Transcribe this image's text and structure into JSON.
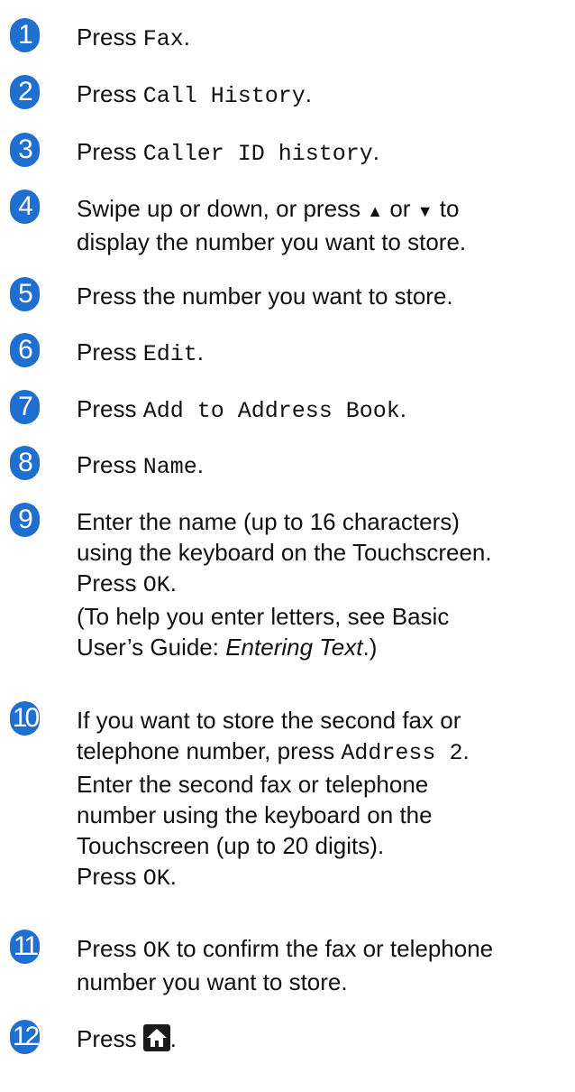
{
  "colors": {
    "badge": "#1f6fd0",
    "text": "#111111"
  },
  "steps": [
    {
      "num": "1",
      "pre": "Press ",
      "code": "Fax",
      "post": "."
    },
    {
      "num": "2",
      "pre": "Press ",
      "code": "Call History",
      "post": "."
    },
    {
      "num": "3",
      "pre": "Press ",
      "code": "Caller ID history",
      "post": "."
    },
    {
      "num": "4",
      "line1_a": "Swipe up or down, or press ",
      "up": "▲",
      "or": " or ",
      "down": "▼",
      "line1_b": " to",
      "line2": "display the number you want to store."
    },
    {
      "num": "5",
      "text": "Press the number you want to store."
    },
    {
      "num": "6",
      "pre": "Press ",
      "code": "Edit",
      "post": "."
    },
    {
      "num": "7",
      "pre": "Press ",
      "code": "Add to Address Book",
      "post": "."
    },
    {
      "num": "8",
      "pre": "Press ",
      "code": "Name",
      "post": "."
    },
    {
      "num": "9",
      "line1": "Enter the name (up to 16 characters)",
      "line2": "using the keyboard on the Touchscreen.",
      "line3_pre": "Press ",
      "line3_code": "OK",
      "line3_post": ".",
      "line4": "(To help you enter letters, see Basic",
      "line5_pre": "User’s Guide: ",
      "line5_ital": "Entering Text",
      "line5_post": ".)"
    },
    {
      "num": "10",
      "line1": "If you want to store the second fax or",
      "line2_pre": "telephone number, press ",
      "line2_code": "Address 2",
      "line2_post": ".",
      "line3": "Enter the second fax or telephone",
      "line4": "number using the keyboard on the",
      "line5": "Touchscreen (up to 20 digits).",
      "line6_pre": "Press ",
      "line6_code": "OK",
      "line6_post": "."
    },
    {
      "num": "11",
      "line1_pre": "Press ",
      "line1_code": "OK",
      "line1_post": " to confirm the fax or telephone",
      "line2": "number you want to store."
    },
    {
      "num": "12",
      "pre": "Press ",
      "icon": "home-icon",
      "post": "."
    }
  ]
}
